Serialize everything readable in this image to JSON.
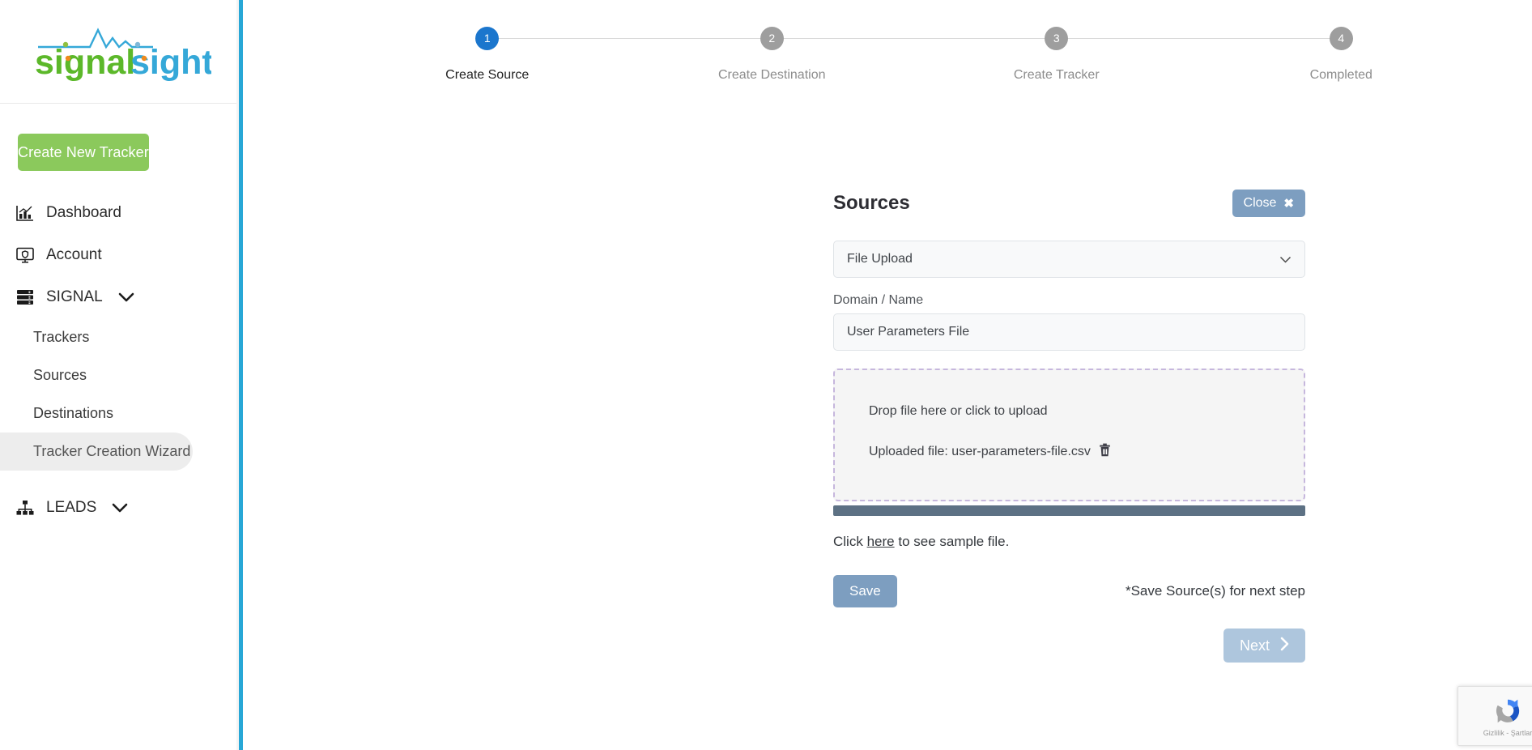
{
  "sidebar": {
    "logo": {
      "part1": "signal",
      "part2": "sight",
      "icon": "ekg-waveform"
    },
    "create_button": "Create New Tracker",
    "nav": [
      {
        "label": "Dashboard",
        "icon": "bar-chart-icon"
      },
      {
        "label": "Account",
        "icon": "monitor-shield-icon"
      },
      {
        "label": "SIGNAL",
        "icon": "server-stack-icon",
        "chevron": "chevron-down-icon"
      }
    ],
    "sub_items": [
      {
        "label": "Trackers",
        "active": false
      },
      {
        "label": "Sources",
        "active": false
      },
      {
        "label": "Destinations",
        "active": false
      },
      {
        "label": "Tracker Creation Wizard",
        "active": true
      }
    ],
    "leads": {
      "label": "LEADS",
      "icon": "sitemap-icon",
      "chevron": "chevron-down-icon"
    }
  },
  "stepper": {
    "steps": [
      {
        "number": "1",
        "label": "Create Source",
        "state": "active"
      },
      {
        "number": "2",
        "label": "Create Destination",
        "state": "inactive"
      },
      {
        "number": "3",
        "label": "Create Tracker",
        "state": "inactive"
      },
      {
        "number": "4",
        "label": "Completed",
        "state": "inactive"
      }
    ]
  },
  "card": {
    "title": "Sources",
    "close_label": "Close",
    "close_icon": "close-x-icon",
    "source_type": {
      "selected": "File Upload",
      "options": [
        "File Upload"
      ],
      "chevron": "chevron-down-icon"
    },
    "domain_name": {
      "label": "Domain / Name",
      "value": "User Parameters File",
      "placeholder": "Domain / Name"
    },
    "dropzone": {
      "prompt": "Drop file here or click to upload",
      "uploaded_prefix": "Uploaded file:",
      "uploaded_file": "user-parameters-file.csv",
      "delete_icon": "trash-icon"
    },
    "progress": {
      "percent": 100
    },
    "sample": {
      "prefix": "Click",
      "link": "here",
      "suffix": "to see sample file."
    },
    "save_label": "Save",
    "hint": "*Save Source(s) for next step",
    "next_label": "Next",
    "next_icon": "chevron-right-icon"
  },
  "recaptcha": {
    "text": "Gizlilik - Şartlar",
    "icon": "recaptcha-icon"
  },
  "colors": {
    "accent_green": "#8bc95c",
    "logo_green": "#5cb82a",
    "logo_blue": "#35a8d8",
    "step_active": "#1b76cd",
    "step_inactive": "#9e9e9e",
    "button_blue": "#7d9ec0",
    "button_blue_disabled": "#aec6dd",
    "progress_fill": "#5d7184",
    "dropzone_border": "#c6b7dd",
    "scrollbar": "#28a7d6"
  }
}
